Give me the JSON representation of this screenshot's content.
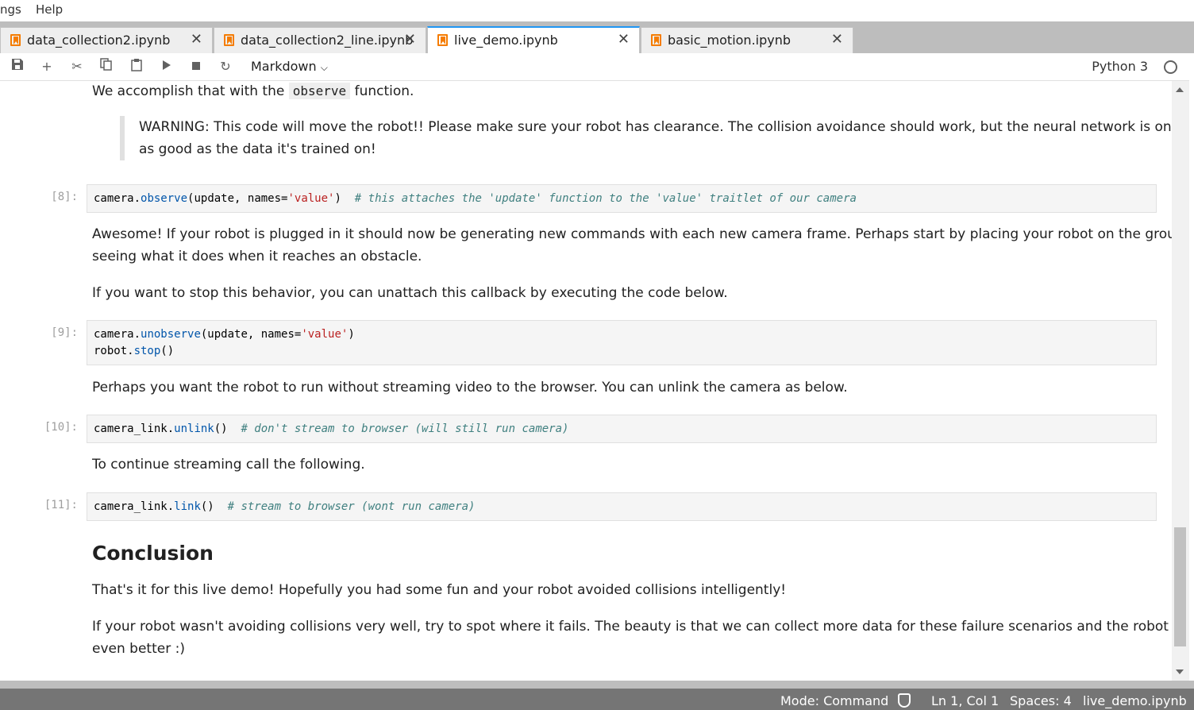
{
  "menubar": {
    "items": [
      "ngs",
      "Help"
    ]
  },
  "tabs": [
    {
      "label": "data_collection2.ipynb",
      "active": false
    },
    {
      "label": "data_collection2_line.ipynb",
      "active": false
    },
    {
      "label": "live_demo.ipynb",
      "active": true
    },
    {
      "label": "basic_motion.ipynb",
      "active": false
    }
  ],
  "toolbar": {
    "cell_type": "Markdown",
    "kernel": "Python 3"
  },
  "notebook": {
    "md1_before": "We accomplish that with the",
    "md1_code": "observe",
    "md1_after": "function.",
    "warning_line1": "WARNING: This code will move the robot!! Please make sure your robot has clearance. The collision avoidance should work, but the neural network is only",
    "warning_line2": "as good as the data it's trained on!",
    "cell8_prompt": "[8]:",
    "md2_line1": "Awesome! If your robot is plugged in it should now be generating new commands with each new camera frame. Perhaps start by placing your robot on the ground and",
    "md2_line2": "seeing what it does when it reaches an obstacle.",
    "md3": "If you want to stop this behavior, you can unattach this callback by executing the code below.",
    "cell9_prompt": "[9]:",
    "md4": "Perhaps you want the robot to run without streaming video to the browser. You can unlink the camera as below.",
    "cell10_prompt": "[10]:",
    "md5": "To continue streaming call the following.",
    "cell11_prompt": "[11]:",
    "heading": "Conclusion",
    "md6": "That's it for this live demo! Hopefully you had some fun and your robot avoided collisions intelligently!",
    "md7_line1": "If your robot wasn't avoiding collisions very well, try to spot where it fails. The beauty is that we can collect more data for these failure scenarios and the robot should get",
    "md7_line2": "even better :)"
  },
  "statusbar": {
    "mode": "Mode: Command",
    "position": "Ln 1, Col 1",
    "spaces": "Spaces: 4",
    "filename": "live_demo.ipynb"
  },
  "colors": {
    "accent": "#2196f3",
    "notebook_icon": "#f57c00",
    "statusbar": "#757575"
  }
}
